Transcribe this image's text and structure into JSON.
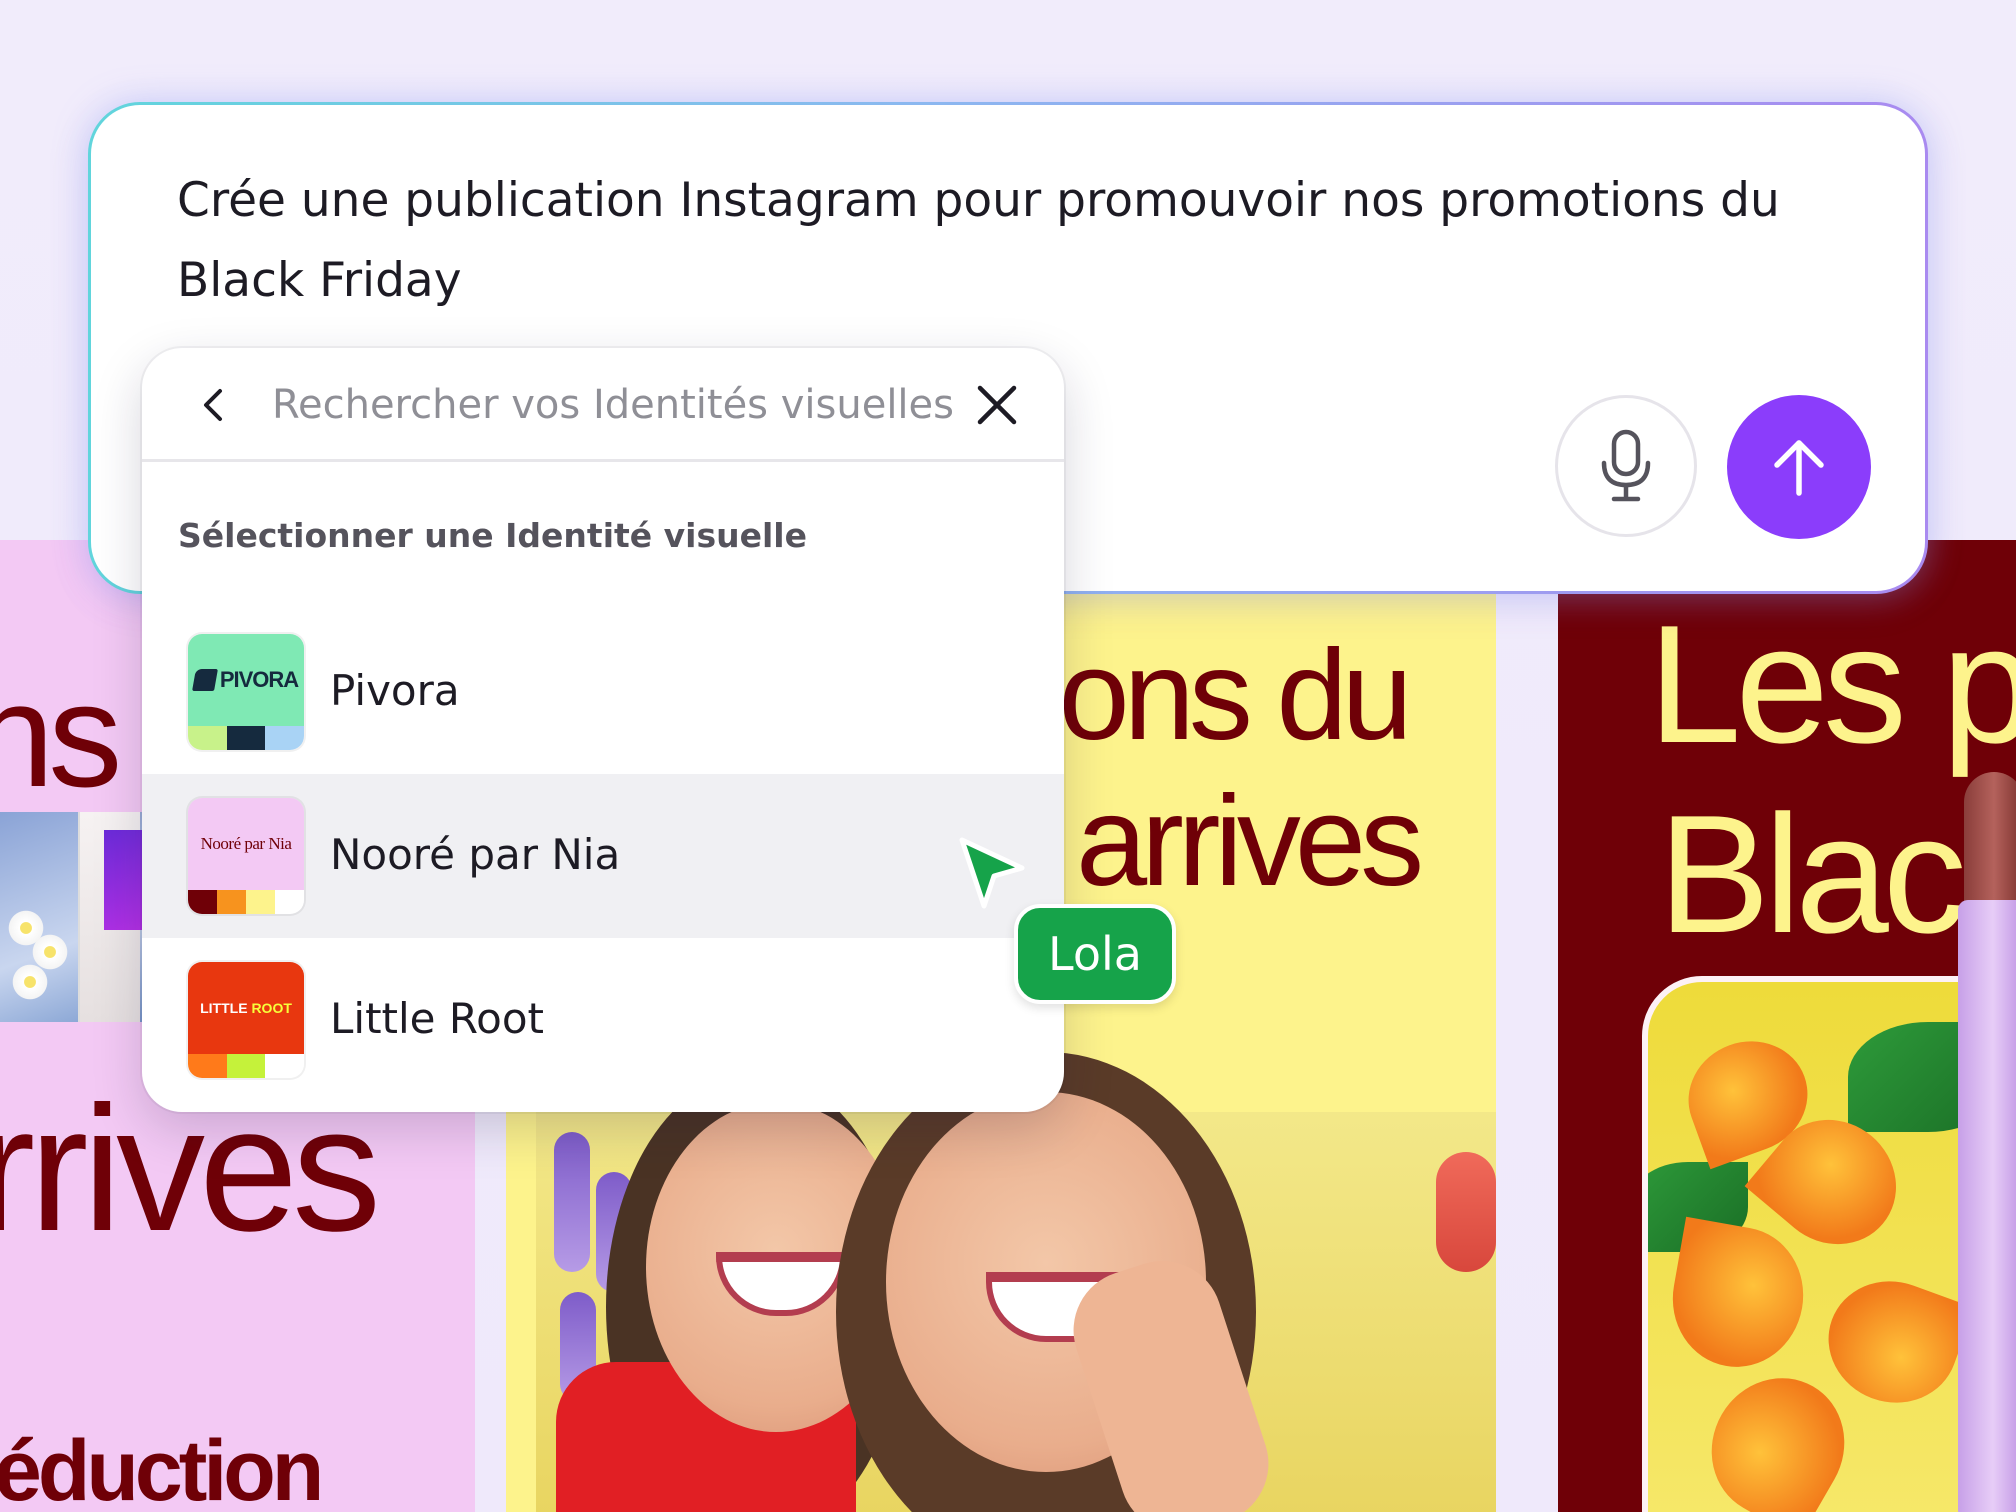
{
  "background_cards": {
    "left": {
      "word_1": "ns d",
      "word_2": "rrives",
      "word_3": "éduction"
    },
    "middle": {
      "line_1": "ions du",
      "line_2": "arrives"
    },
    "right": {
      "line_1": "Les p",
      "line_2": "Black"
    }
  },
  "prompt": {
    "text": "Crée une publication Instagram pour promouvoir nos promotions du Black Friday",
    "mic_icon": "microphone-icon",
    "send_icon": "arrow-up-icon",
    "send_color": "#8b3dfb"
  },
  "brand_kit_picker": {
    "search_placeholder": "Rechercher vos Identités visuelles",
    "back_icon": "chevron-left-icon",
    "clear_icon": "close-icon",
    "heading": "Sélectionner une Identité visuelle",
    "kits": [
      {
        "name": "Pivora",
        "logo_text": "PIVORA",
        "bg": "#7fe9b4",
        "palette": [
          "#c8f28a",
          "#152a3e",
          "#a9d3f5"
        ]
      },
      {
        "name": "Nooré par Nia",
        "logo_text": "Nooré par Nia",
        "bg": "#f3c9f4",
        "palette": [
          "#6f0007",
          "#f7931e",
          "#fdf38c",
          "#ffffff"
        ]
      },
      {
        "name": "Little Root",
        "logo_text_1": "LITTLE",
        "logo_text_2": "ROOT",
        "bg": "#e8370f",
        "palette": [
          "#ff7a1a",
          "#c5f23a",
          "#ffffff"
        ]
      }
    ]
  },
  "collaborator": {
    "name": "Lola",
    "color": "#16a34a"
  }
}
